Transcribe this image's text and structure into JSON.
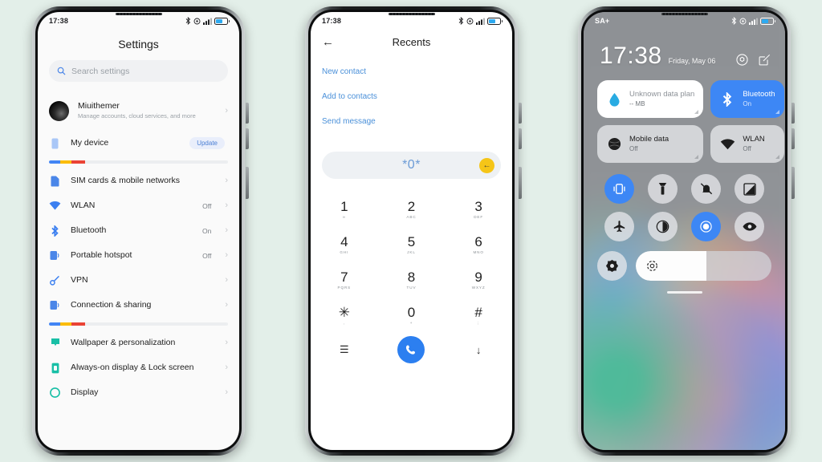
{
  "background_color": "#e3efe9",
  "phones": {
    "settings": {
      "status_bar": {
        "time": "17:38",
        "icons": [
          "bluetooth-icon",
          "alarm-icon",
          "signal-icon",
          "battery-icon"
        ]
      },
      "title": "Settings",
      "search": {
        "placeholder": "Search settings",
        "icon": "search-icon"
      },
      "account": {
        "name": "Miuithemer",
        "subtitle": "Manage accounts, cloud services, and more",
        "chevron": "›"
      },
      "my_device": {
        "label": "My device",
        "action_label": "Update",
        "icon": "phone-icon"
      },
      "items": [
        {
          "label": "SIM cards & mobile networks",
          "value": "",
          "icon": "sim-icon",
          "chevron": "›"
        },
        {
          "label": "WLAN",
          "value": "Off",
          "icon": "wifi-icon",
          "chevron": "›"
        },
        {
          "label": "Bluetooth",
          "value": "On",
          "icon": "bluetooth-icon",
          "chevron": "›"
        },
        {
          "label": "Portable hotspot",
          "value": "Off",
          "icon": "hotspot-icon",
          "chevron": "›"
        },
        {
          "label": "VPN",
          "value": "",
          "icon": "vpn-key-icon",
          "chevron": "›"
        },
        {
          "label": "Connection & sharing",
          "value": "",
          "icon": "connection-icon",
          "chevron": "›"
        }
      ],
      "items2": [
        {
          "label": "Wallpaper & personalization",
          "value": "",
          "icon": "wallpaper-icon",
          "chevron": "›"
        },
        {
          "label": "Always-on display & Lock screen",
          "value": "",
          "icon": "aod-icon",
          "chevron": "›"
        },
        {
          "label": "Display",
          "value": "",
          "icon": "display-icon",
          "chevron": "›"
        }
      ]
    },
    "dialer": {
      "status_bar": {
        "time": "17:38"
      },
      "title": "Recents",
      "back_icon": "arrow-left-icon",
      "links": [
        "New contact",
        "Add to contacts",
        "Send message"
      ],
      "input_value": "*0*",
      "delete_icon": "backspace-icon",
      "keys": [
        {
          "digit": "1",
          "letters": "∞"
        },
        {
          "digit": "2",
          "letters": "ABC"
        },
        {
          "digit": "3",
          "letters": "DEF"
        },
        {
          "digit": "4",
          "letters": "GHI"
        },
        {
          "digit": "5",
          "letters": "JKL"
        },
        {
          "digit": "6",
          "letters": "MNO"
        },
        {
          "digit": "7",
          "letters": "PQRS"
        },
        {
          "digit": "8",
          "letters": "TUV"
        },
        {
          "digit": "9",
          "letters": "WXYZ"
        },
        {
          "digit": "✳",
          "letters": ","
        },
        {
          "digit": "0",
          "letters": "+"
        },
        {
          "digit": "#",
          "letters": ";"
        }
      ],
      "bottom_left_icon": "menu-icon",
      "call_icon": "call-icon",
      "bottom_right_icon": "arrow-down-icon"
    },
    "control_center": {
      "status_bar": {
        "carrier": "SA+",
        "icons": [
          "bluetooth-icon",
          "alarm-icon",
          "signal-icon",
          "battery-icon"
        ]
      },
      "time": "17:38",
      "date": "Friday, May 06",
      "header_icons": [
        "settings-gear-icon",
        "edit-icon"
      ],
      "big_tiles": [
        {
          "title": "Unknown data plan",
          "subtitle": "-- MB",
          "icon": "data-drop-icon",
          "state": "white"
        },
        {
          "title": "Bluetooth",
          "subtitle": "On",
          "icon": "bluetooth-icon",
          "state": "on"
        },
        {
          "title": "Mobile data",
          "subtitle": "Off",
          "icon": "mobile-data-icon",
          "state": "off"
        },
        {
          "title": "WLAN",
          "subtitle": "Off",
          "icon": "wifi-icon",
          "state": "off"
        }
      ],
      "toggles": [
        {
          "name": "vibrate-icon",
          "on": true
        },
        {
          "name": "flashlight-icon",
          "on": false
        },
        {
          "name": "silent-bell-icon",
          "on": false
        },
        {
          "name": "auto-brightness-icon",
          "on": false
        },
        {
          "name": "airplane-mode-icon",
          "on": false
        },
        {
          "name": "dark-mode-icon",
          "on": false
        },
        {
          "name": "location-icon",
          "on": true
        },
        {
          "name": "reading-mode-eye-icon",
          "on": false
        }
      ],
      "extra_toggle": {
        "name": "app-settings-icon",
        "on": false
      },
      "brightness": {
        "icon": "brightness-sun-icon",
        "percent": 52
      },
      "home_indicator": true
    }
  },
  "colors": {
    "accent_blue": "#3d87f5",
    "link_blue": "#4a90d9",
    "yellow": "#f5c518",
    "tile_grey": "#e4e6e9"
  }
}
